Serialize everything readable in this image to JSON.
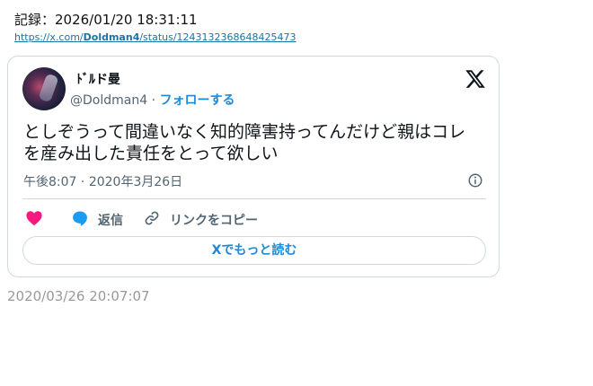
{
  "record": {
    "text": "記録：2026/01/20 18:31:11"
  },
  "url": {
    "prefix": "https://x.com/",
    "bold": "Doldman4",
    "suffix": "/status/1243132368648425473"
  },
  "tweet": {
    "display_name": "ﾄﾞﾙド曼",
    "handle": "@Doldman4",
    "separator": " · ",
    "follow_label": "フォローする",
    "text": "としぞうって間違いなく知的障害持ってんだけど親はコレを産み出した責任をとって欲しい",
    "time": "午後8:07",
    "date_sep": " · ",
    "date": "2020年3月26日",
    "reply_label": "返信",
    "copy_link_label": "リンクをコピー",
    "read_more_label": "Xでもっと読む"
  },
  "footer": {
    "timestamp": "2020/03/26 20:07:07"
  },
  "colors": {
    "accent": "#1d8ad8",
    "like": "#f91880",
    "reply": "#1d9bf0",
    "muted": "#536471",
    "border": "#cfd9de"
  },
  "icons": {
    "logo": "x-logo-icon",
    "info": "info-icon",
    "like": "heart-icon",
    "reply": "speech-bubble-icon",
    "link": "link-icon"
  }
}
